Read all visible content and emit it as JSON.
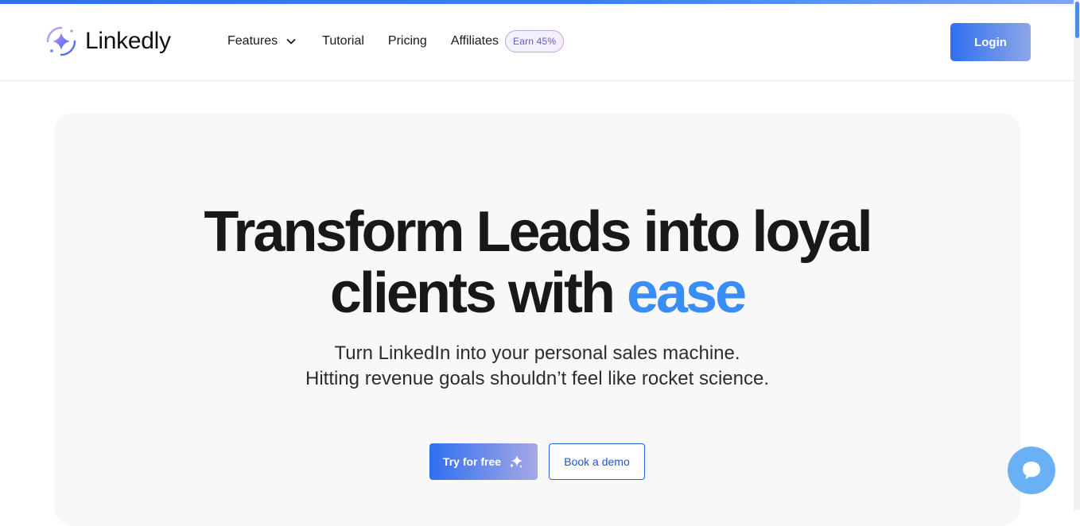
{
  "brand": {
    "name": "Linkedly",
    "logo_icon": "sparkle-logo-icon"
  },
  "nav": {
    "features_label": "Features",
    "tutorial_label": "Tutorial",
    "pricing_label": "Pricing",
    "affiliates_label": "Affiliates",
    "earn_badge": "Earn 45%",
    "login_label": "Login"
  },
  "hero": {
    "title_line1": "Transform Leads into loyal",
    "title_line2_prefix": "clients with ",
    "title_accent": "ease",
    "subtitle_line1": "Turn LinkedIn into your personal sales machine.",
    "subtitle_line2": "Hitting revenue goals shouldn’t feel like rocket science.",
    "primary_cta": "Try for free",
    "secondary_cta": "Book a demo"
  },
  "colors": {
    "brand_blue": "#2f6ff0",
    "accent_word": "#3a8df5",
    "chat_bubble": "#6ab0f5",
    "badge_text": "#6a55d9"
  },
  "icons": {
    "features_dropdown": "chevron-down-icon",
    "cta_sparkle": "sparkle-icon",
    "chat": "chat-bubble-icon"
  }
}
